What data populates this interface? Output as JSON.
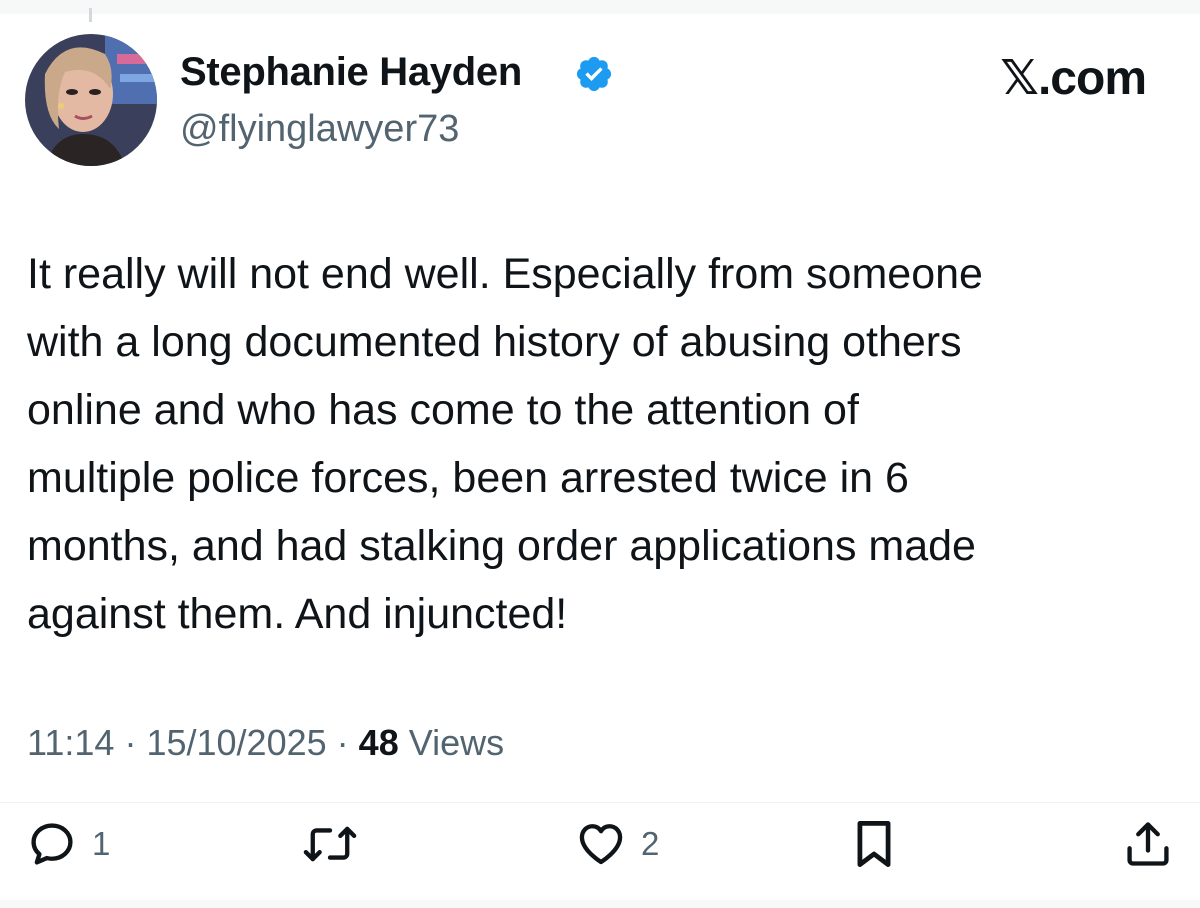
{
  "brand": "𝕏.com",
  "author": {
    "display_name": "Stephanie Hayden",
    "handle": "@flyinglawyer73",
    "verified": true,
    "verified_color": "#1d9bf0"
  },
  "tweet": {
    "text": "It really will not end well. Especially from someone\nwith a long documented history of abusing others\nonline and who has come to the attention of\nmultiple police forces, been arrested twice in 6\nmonths, and had stalking order applications made\nagainst them. And injuncted!"
  },
  "meta": {
    "time": "11:14",
    "separator": "·",
    "date": "15/10/2025",
    "views_count": "48",
    "views_label": "Views"
  },
  "actions": {
    "reply": {
      "icon": "reply-icon",
      "count": "1"
    },
    "retweet": {
      "icon": "retweet-icon",
      "count": ""
    },
    "like": {
      "icon": "like-heart-icon",
      "count": "2"
    },
    "bookmark": {
      "icon": "bookmark-icon",
      "count": ""
    },
    "share": {
      "icon": "share-icon",
      "count": ""
    }
  },
  "colors": {
    "text": "#0f1419",
    "secondary": "#536471",
    "accent": "#1d9bf0"
  }
}
